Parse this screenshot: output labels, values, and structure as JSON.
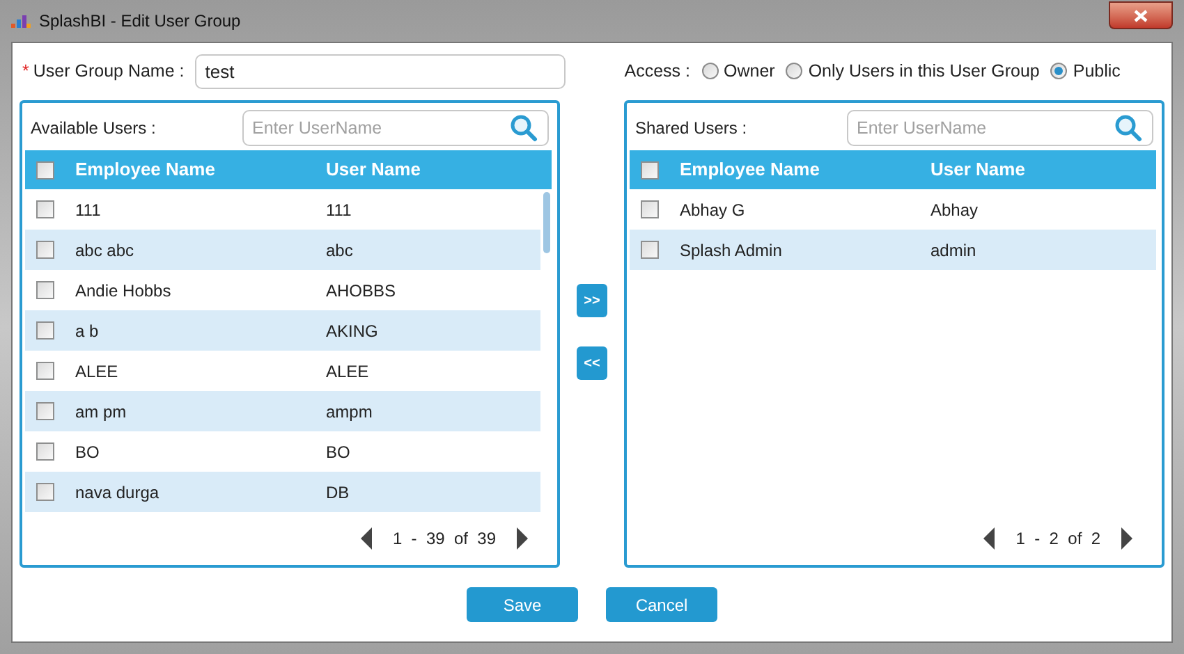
{
  "window": {
    "title": "SplashBI - Edit User Group"
  },
  "group_name": {
    "required_mark": "*",
    "label": "User Group Name :",
    "value": "test"
  },
  "access": {
    "label": "Access :",
    "options": [
      {
        "label": "Owner",
        "selected": false
      },
      {
        "label": "Only Users in this User Group",
        "selected": false
      },
      {
        "label": "Public",
        "selected": true
      }
    ]
  },
  "available": {
    "title": "Available Users :",
    "search": {
      "placeholder": "Enter UserName"
    },
    "all_checked": false,
    "columns": [
      "Employee Name",
      "User Name"
    ],
    "rows": [
      {
        "employee": "111",
        "user": "111",
        "checked": false
      },
      {
        "employee": "abc abc",
        "user": "abc",
        "checked": false
      },
      {
        "employee": "Andie Hobbs",
        "user": "AHOBBS",
        "checked": false
      },
      {
        "employee": "a b",
        "user": "AKING",
        "checked": false
      },
      {
        "employee": "ALEE",
        "user": "ALEE",
        "checked": false
      },
      {
        "employee": "am pm",
        "user": "ampm",
        "checked": false
      },
      {
        "employee": "BO",
        "user": "BO",
        "checked": false
      },
      {
        "employee": "nava durga",
        "user": "DB",
        "checked": false
      }
    ],
    "pager": "1  -  39  of  39"
  },
  "move_buttons": [
    ">>",
    "<<"
  ],
  "shared": {
    "title": "Shared Users :",
    "search": {
      "placeholder": "Enter UserName"
    },
    "all_checked": false,
    "columns": [
      "Employee Name",
      "User Name"
    ],
    "rows": [
      {
        "employee": "Abhay G",
        "user": "Abhay",
        "checked": false
      },
      {
        "employee": "Splash Admin",
        "user": "admin",
        "checked": false
      }
    ],
    "pager": "1  -  2  of  2"
  },
  "buttons": [
    "Save",
    "Cancel"
  ]
}
